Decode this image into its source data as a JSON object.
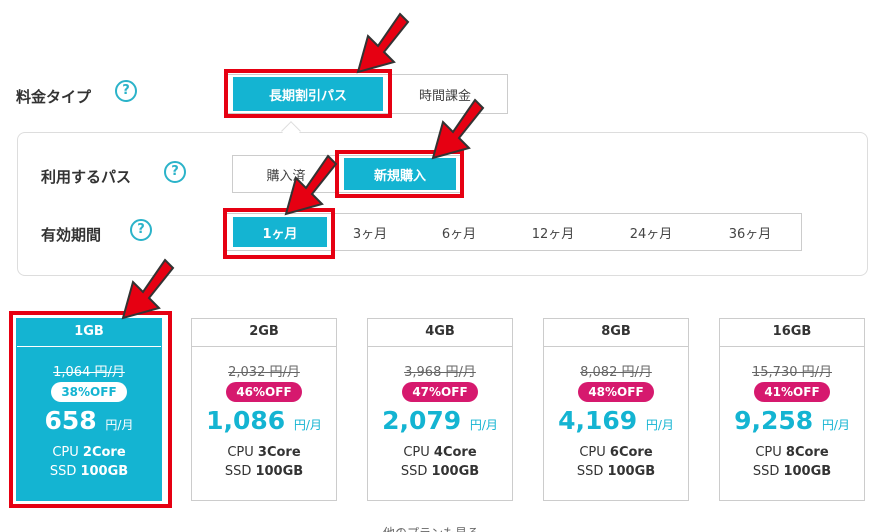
{
  "plan_type": {
    "label": "料金タイプ",
    "help": "?",
    "options": [
      "長期割引パス",
      "時間課金"
    ],
    "selected": "長期割引パス"
  },
  "pass_usage": {
    "label": "利用するパス",
    "help": "?",
    "options": [
      "購入済",
      "新規購入"
    ],
    "selected": "新規購入"
  },
  "period": {
    "label": "有効期間",
    "help": "?",
    "options": [
      "1ヶ月",
      "3ヶ月",
      "6ヶ月",
      "12ヶ月",
      "24ヶ月",
      "36ヶ月"
    ],
    "selected": "1ヶ月"
  },
  "plans": [
    {
      "name": "1GB",
      "old_price": "1,064 円/月",
      "discount": "38%OFF",
      "price": "658",
      "unit": "円/月",
      "cpu_label": "CPU",
      "cpu": "2Core",
      "ssd_label": "SSD",
      "ssd": "100GB",
      "selected": true
    },
    {
      "name": "2GB",
      "old_price": "2,032 円/月",
      "discount": "46%OFF",
      "price": "1,086",
      "unit": "円/月",
      "cpu_label": "CPU",
      "cpu": "3Core",
      "ssd_label": "SSD",
      "ssd": "100GB",
      "selected": false
    },
    {
      "name": "4GB",
      "old_price": "3,968 円/月",
      "discount": "47%OFF",
      "price": "2,079",
      "unit": "円/月",
      "cpu_label": "CPU",
      "cpu": "4Core",
      "ssd_label": "SSD",
      "ssd": "100GB",
      "selected": false
    },
    {
      "name": "8GB",
      "old_price": "8,082 円/月",
      "discount": "48%OFF",
      "price": "4,169",
      "unit": "円/月",
      "cpu_label": "CPU",
      "cpu": "6Core",
      "ssd_label": "SSD",
      "ssd": "100GB",
      "selected": false
    },
    {
      "name": "16GB",
      "old_price": "15,730 円/月",
      "discount": "41%OFF",
      "price": "9,258",
      "unit": "円/月",
      "cpu_label": "CPU",
      "cpu": "8Core",
      "ssd_label": "SSD",
      "ssd": "100GB",
      "selected": false
    }
  ],
  "footer": {
    "text": "他のプランも見る"
  },
  "colors": {
    "accent": "#14b4d2",
    "badge": "#d6196e",
    "highlight": "#e60012"
  }
}
